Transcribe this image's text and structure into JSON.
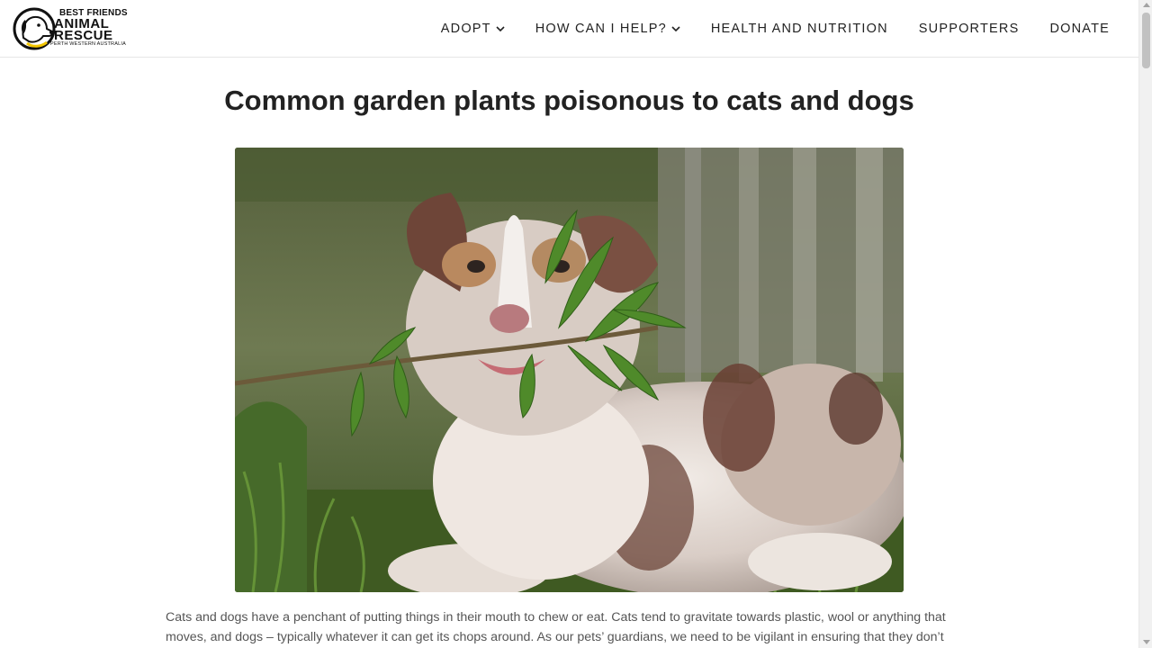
{
  "logo": {
    "line1": "BEST FRIENDS",
    "line2": "ANIMAL",
    "line3": "RESCUE",
    "line4": "PERTH WESTERN AUSTRALIA",
    "icon": "dog-head-icon"
  },
  "nav": {
    "items": [
      {
        "label": "ADOPT",
        "has_dropdown": true
      },
      {
        "label": "HOW CAN I HELP?",
        "has_dropdown": true
      },
      {
        "label": "HEALTH AND NUTRITION",
        "has_dropdown": false
      },
      {
        "label": "SUPPORTERS",
        "has_dropdown": false
      },
      {
        "label": "DONATE",
        "has_dropdown": false
      }
    ]
  },
  "article": {
    "title": "Common garden plants poisonous to cats and dogs",
    "image_alt": "puppy-chewing-plant-photo",
    "paragraph_line1": "Cats and dogs have a penchant of putting things in their mouth to chew or eat. Cats tend to gravitate towards plastic, wool or anything that",
    "paragraph_line2": "moves, and dogs – typically whatever it can get its chops around. As our pets’ guardians, we need to be vigilant in ensuring that they don’t"
  },
  "colors": {
    "text": "#222222",
    "body_text": "#555555",
    "border": "#e6e6e6",
    "logo_accent": "#f2c500"
  }
}
